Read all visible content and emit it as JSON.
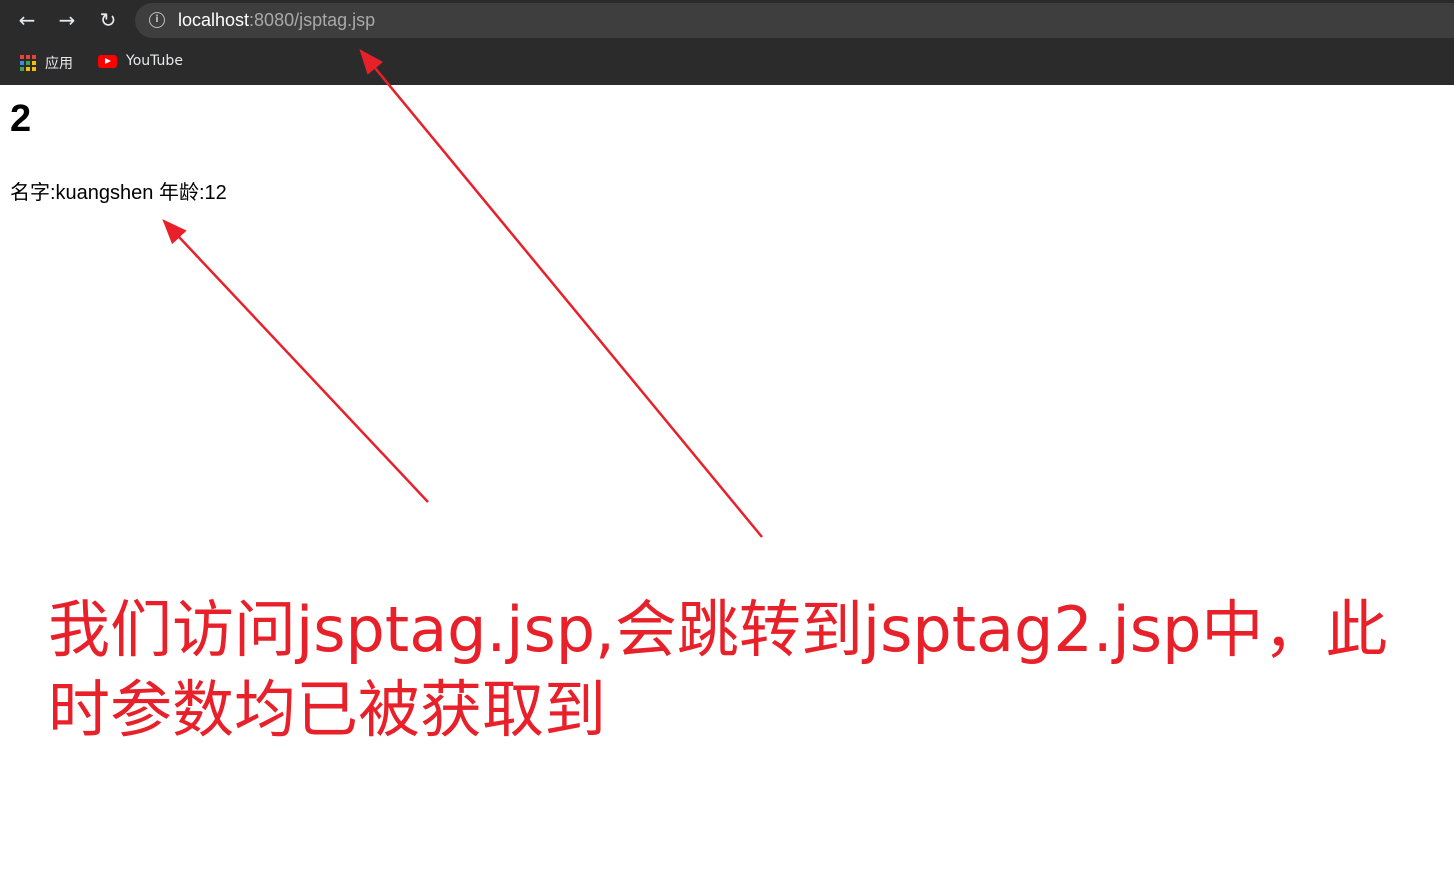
{
  "browser": {
    "back_icon": "arrow-left",
    "forward_icon": "arrow-right",
    "reload_icon": "reload",
    "url_host": "localhost",
    "url_path": ":8080/jsptag.jsp",
    "bookmarks": [
      {
        "label": "应用",
        "icon": "apps-grid"
      },
      {
        "label": "YouTube",
        "icon": "youtube-logo"
      }
    ]
  },
  "page": {
    "heading": "2",
    "info_line": "名字:kuangshen 年龄:12"
  },
  "annotation": {
    "text": "我们访问jsptag.jsp,会跳转到jsptag2.jsp中，此时参数均已被获取到",
    "color": "#e8202a"
  }
}
